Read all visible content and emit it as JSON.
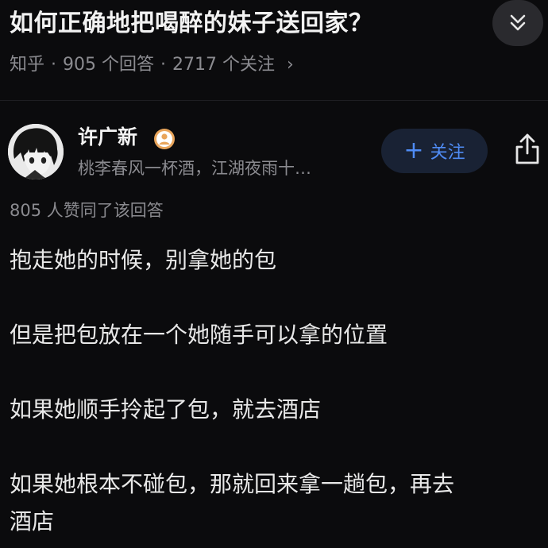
{
  "question": {
    "title": "如何正确地把喝醉的妹子送回家？",
    "source": "知乎",
    "answers": "905 个回答",
    "followers": "2717 个关注",
    "chevron": "›",
    "collapse_icon": "chevron-double-down-icon"
  },
  "author": {
    "name": "许广新",
    "bio": "桃李春风一杯酒，江湖夜雨十…",
    "badge_icon": "person-badge-icon",
    "follow_label": "关注",
    "follow_plus": "+"
  },
  "colors": {
    "background": "#0b0b0d",
    "accent": "#4f8cf5",
    "follow_bg": "#192234",
    "badge": "#e9a55b",
    "secondary_text": "#8b8b90"
  },
  "answer": {
    "votes": "805 人赞同了该回答",
    "line1": "抱走她的时候，别拿她的包",
    "line2": "但是把包放在一个她随手可以拿的位置",
    "line3": "如果她顺手拎起了包，就去酒店",
    "line4a": "如果她根本不碰包，那就回来拿一趟包，再去",
    "line4b": "酒店"
  }
}
